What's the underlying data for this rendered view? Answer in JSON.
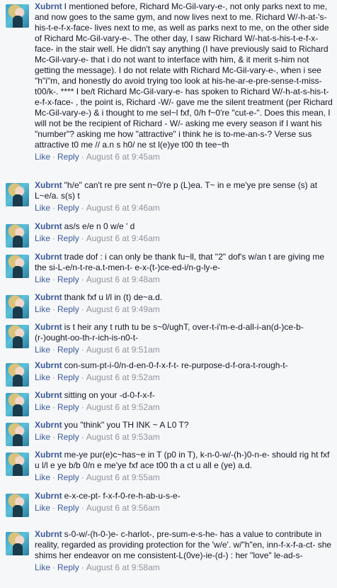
{
  "author": "Xubrnt",
  "like_label": "Like",
  "reply_label": "Reply",
  "separator": "·",
  "comments": [
    {
      "text": "I mentioned before, Richard Mc-Gil-vary-e-, not only parks next to me, and now goes to the same gym, and now lives next to me. Richard W/-h-at-'s-his-t-e-f-x-face- lives next to me, as well as parks next to me, on the other side of Richard Mc-Gil-vary-e-. The other day, I saw Richard W/-hat-s-his-t-e-f-x-face- in the stair well. He didn't say anything (I have previously said to Richard Mc-Gil-vary-e- that i do not want to interface with him, & it merit s-him not getting the message). I do not relate with Richard Mc-Gil-vary-e-, when i see \"h\"i\"m, and honestly do avoid trying too look at his-he-ar-e-pre-sense-t-miss-t00/k-. **** I be/t Richard Mc-Gil-vary-e- has spoken to Richard W/-h-at-s-his-t-e-f-x-face- , the point is, Richard -W/- gave me the silent treatment (per Richard Mc-Gil-vary-e-) & i thought to me sel~l fxf, 0/h f~0're \"cut-e-\". Does this mean, I will not be the recipient of Richard - W/- asking me every season if I want his \"number\"? asking me how \"attractive\" i think he is to-me-an-s-? Verse sus attractive t0 me // a.n s h0/ ne st l(e)ye t00 th tee~th",
      "time": "August 6 at 9:45am"
    },
    {
      "text": "\"h/e\" can't re pre sent n~0're p (L)ea. T~ in e me'ye pre sense (s) at L~e/a. s(s) t",
      "time": "August 6 at 9:46am"
    },
    {
      "text": "as/s e/e n 0 w/e ' d",
      "time": "August 6 at 9:46am"
    },
    {
      "text": "trade dof : i can only be thank fu~ll, that \"2\" dof's w/an t are giving me the si-L-e/n-t-re-a.t-men-t- e-x-(t-)ce-ed-i/n-g-ly-e-",
      "time": "August 6 at 9:48am"
    },
    {
      "text": "thank fxf u l/l in (t) de~a.d.",
      "time": "August 6 at 9:49am"
    },
    {
      "text": "is t heir any t ruth tu be s~0/ughT, over-t-i'm-e-d-all-i-an(d-)ce-b-(r-)ought-oo-th-r-ich-is-n0-t-",
      "time": "August 6 at 9:51am"
    },
    {
      "text": "con-sum-pt-i-0/n-d-en-0-f-x-f-t- re-purpose-d-f-ora-t-rough-t-",
      "time": "August 6 at 9:52am"
    },
    {
      "text": "sitting on your -d-0-f-x-f-",
      "time": "August 6 at 9:52am"
    },
    {
      "text": "you \"think\" you TH INK ~ A L0 T?",
      "time": "August 6 at 9:53am"
    },
    {
      "text": "me-ye pur(e)c~has~e in T (p0 in T), k-n-0-w/-(h-)0-n-e- should rig ht fxf u l/l e ye b/b 0/n e me'ye fxf ace t00 th a ct u all e (ye) a.d.",
      "time": "August 6 at 9:55am"
    },
    {
      "text": "e-x-ce-pt- f-x-f-0-re-h-ab-u-s-e-",
      "time": "August 6 at 9:56am"
    },
    {
      "text": "s-0-w/-(h-0-)e- c-harlot-, pre-sum-e-s-he- has a value to contribute in reality, regarded as providing protection for the 'w/e'. w/\"h\"en, inn-f-x-f-a-ct- she shims her endeavor on me consistent-L(0ve)-ie-(d-) : her \"love\" le-ad-s-",
      "time": "August 6 at 9:58am"
    }
  ]
}
